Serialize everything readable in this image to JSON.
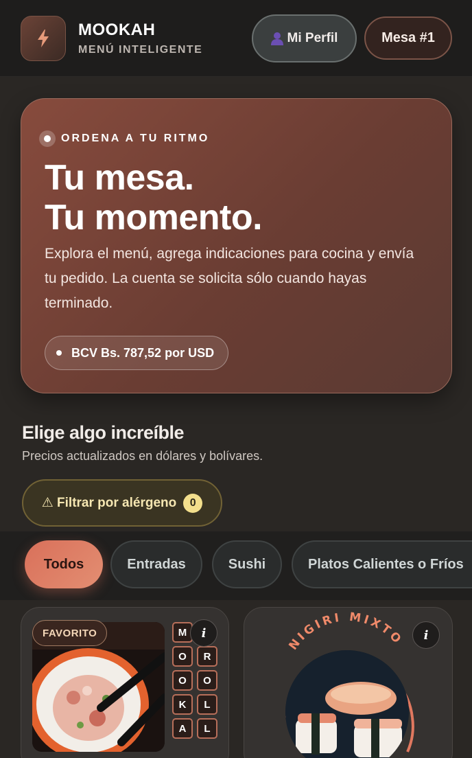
{
  "header": {
    "brand": "MOOKAH",
    "subtitle": "MENÚ INTELIGENTE",
    "profile_label": "Mi Perfil",
    "table_label": "Mesa #1",
    "logo_icon": "bolt-icon",
    "profile_icon": "user-icon"
  },
  "hero": {
    "eyebrow": "ORDENA A TU RITMO",
    "title_line1": "Tu mesa.",
    "title_line2": "Tu momento.",
    "description": "Explora el menú, agrega indicaciones para cocina y envía tu pedido. La cuenta se solicita sólo cuando hayas terminado.",
    "rate": "BCV Bs. 787,52 por USD"
  },
  "section": {
    "title": "Elige algo increíble",
    "subtitle": "Precios actualizados en dólares y bolívares."
  },
  "filter": {
    "label": "⚠ Filtrar por alérgeno",
    "count": "0"
  },
  "tabs": [
    {
      "label": "Todos",
      "active": true
    },
    {
      "label": "Entradas",
      "active": false
    },
    {
      "label": "Sushi",
      "active": false
    },
    {
      "label": "Platos Calientes o Fríos",
      "active": false
    }
  ],
  "cards": [
    {
      "badge": "FAVORITO",
      "letters": [
        "M",
        "",
        "O",
        "R",
        "O",
        "O",
        "K",
        "L",
        "A",
        "L"
      ],
      "info": "i"
    },
    {
      "arc_title": "NIGIRI MIXTO",
      "info": "i"
    }
  ],
  "colors": {
    "accent": "#d9705a",
    "hero_bg": "#7a4538",
    "filter_text": "#f6e7b2"
  }
}
